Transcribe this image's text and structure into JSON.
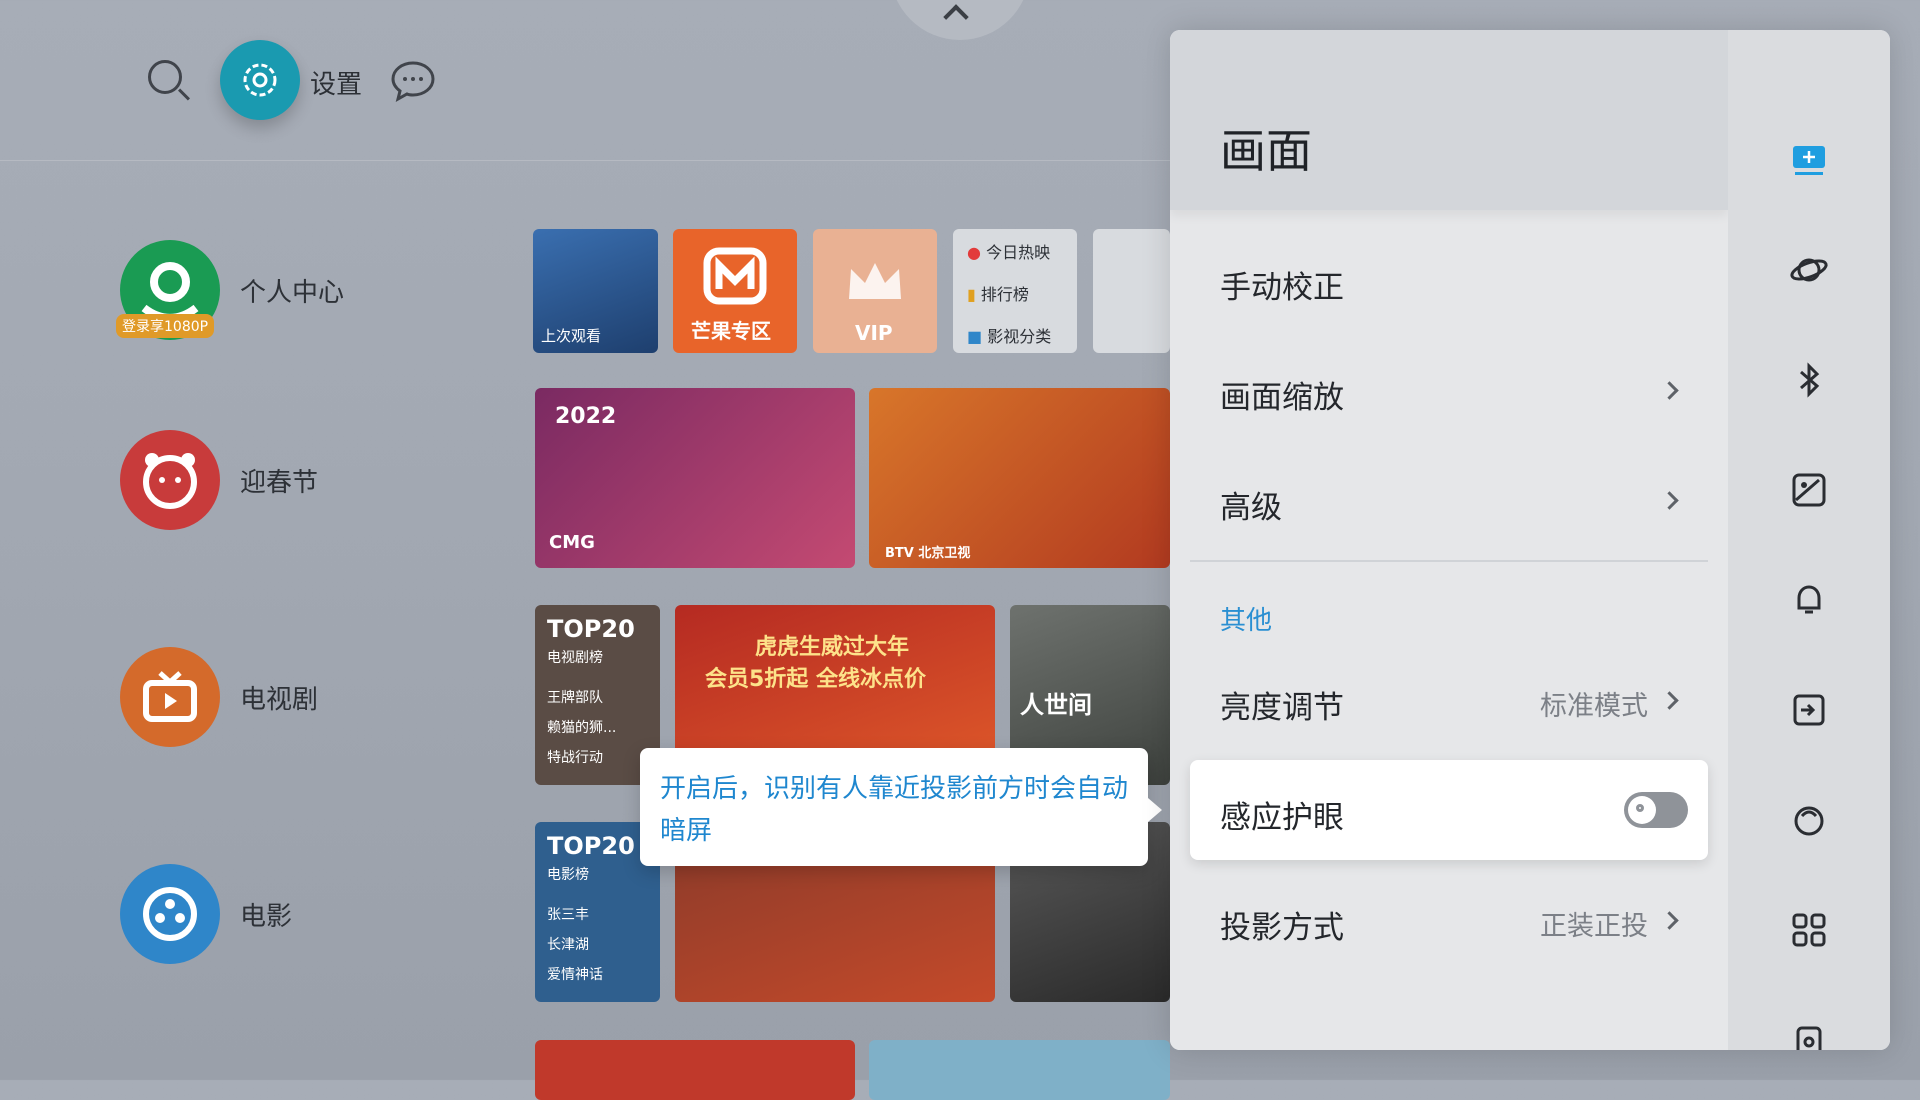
{
  "header": {
    "settings_label": "设置"
  },
  "nav": [
    {
      "label": "个人中心",
      "badge": "登录享1080P",
      "color": "#1a9b53"
    },
    {
      "label": "迎春节",
      "color": "#c83b3b"
    },
    {
      "label": "电视剧",
      "color": "#d46a2b"
    },
    {
      "label": "电影",
      "color": "#2f86c9"
    }
  ],
  "tiles": {
    "recent_label": "上次观看",
    "mango_label": "芒果专区",
    "vip_label": "VIP",
    "menu": [
      "今日热映",
      "排行榜",
      "影视分类"
    ],
    "banner1_tag": "CMG",
    "banner1_year": "2022",
    "banner2_tag": "BTV 北京卫视",
    "top20_tv_title": "TOP20",
    "top20_tv_sub": "电视剧榜",
    "top20_tv_items": [
      "王牌部队",
      "赖猫的狮...",
      "特战行动"
    ],
    "promo_line1": "虎虎生威过大年",
    "promo_line2": "会员5折起 全线冰点价",
    "drama_title": "人世间",
    "top20_movie_title": "TOP20",
    "top20_movie_sub": "电影榜",
    "top20_movie_items": [
      "张三丰",
      "长津湖",
      "爱情神话"
    ]
  },
  "panel": {
    "title": "画面",
    "rows": [
      {
        "label": "手动校正"
      },
      {
        "label": "画面缩放"
      },
      {
        "label": "高级"
      }
    ],
    "section": "其他",
    "brightness_label": "亮度调节",
    "brightness_value": "标准模式",
    "eye_label": "感应护眼",
    "eye_on": false,
    "projection_label": "投影方式",
    "projection_value": "正装正投"
  },
  "rail_icons": [
    "display-icon",
    "planet-icon",
    "bluetooth-icon",
    "image-icon",
    "bell-icon",
    "input-icon",
    "face-icon",
    "apps-icon",
    "speaker-icon"
  ],
  "tooltip": "开启后，识别有人靠近投影前方时会自动暗屏"
}
